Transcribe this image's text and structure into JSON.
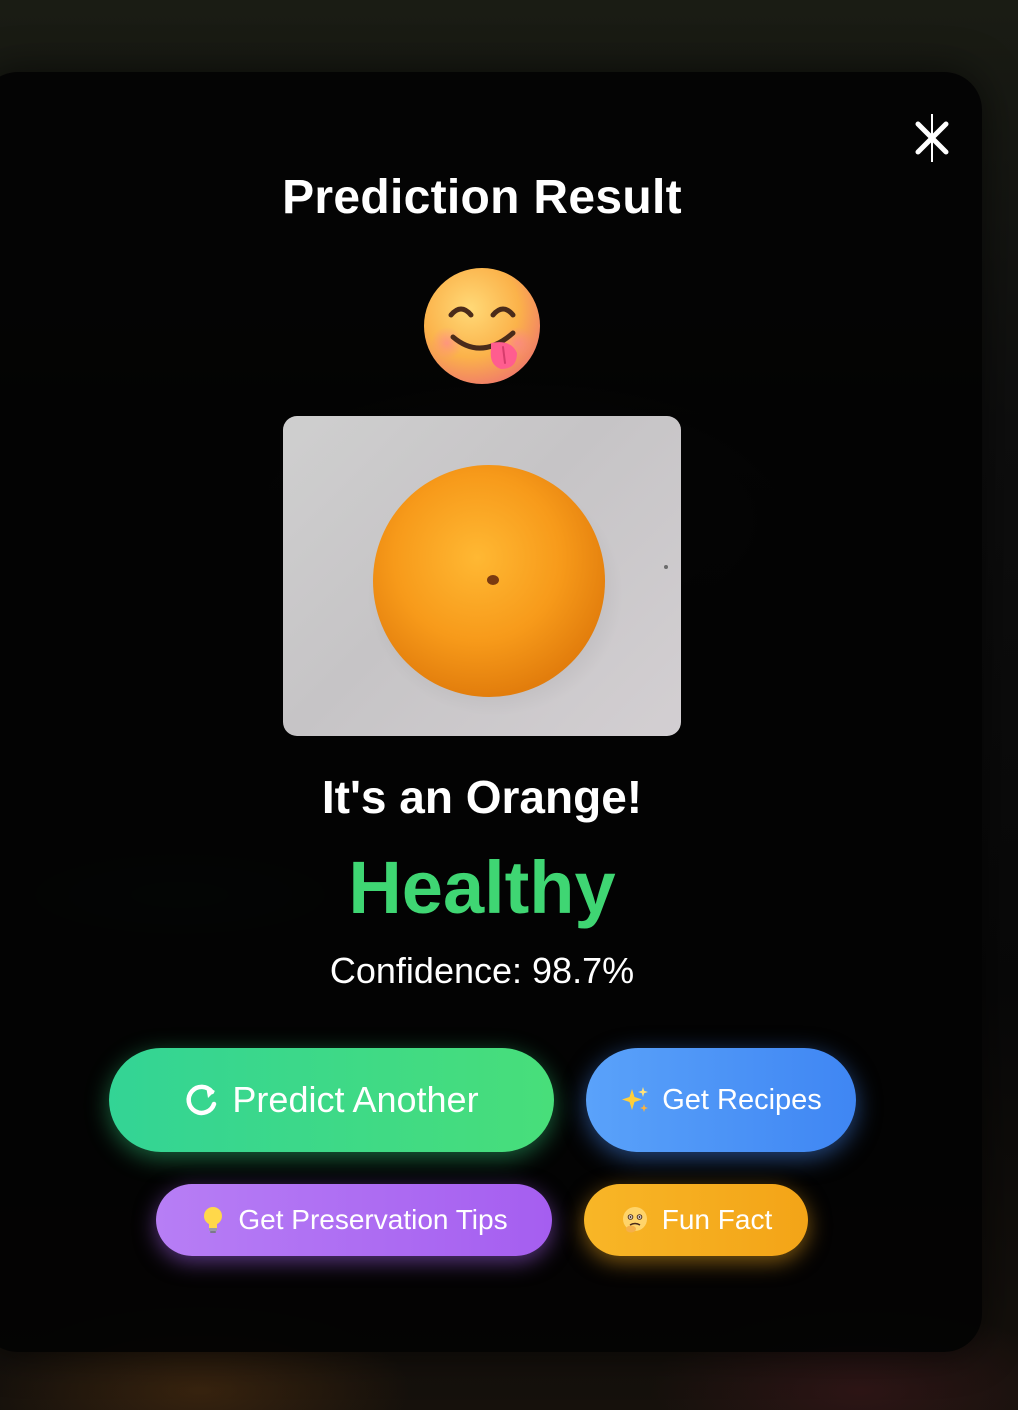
{
  "modal": {
    "title": "Prediction Result",
    "close_icon": "close-icon",
    "reaction_icon": "yum-face-emoji-icon",
    "fruit_image": "orange-photo",
    "fruit_label": "It's an Orange!",
    "health_status": "Healthy",
    "confidence_text": "Confidence: 98.7%"
  },
  "actions": {
    "predict_another": {
      "label": "Predict Another",
      "icon": "refresh-icon",
      "color": "#3fd88a"
    },
    "get_recipes": {
      "label": "Get Recipes",
      "icon": "sparkles-icon",
      "color": "#4a8ff6"
    },
    "preservation_tips": {
      "label": "Get Preservation Tips",
      "icon": "lightbulb-icon",
      "color": "#ad6ef2"
    },
    "fun_fact": {
      "label": "Fun Fact",
      "icon": "thinking-face-icon",
      "color": "#f6ad20"
    }
  },
  "colors": {
    "healthy": "#3fd673",
    "modal_background": "#030303"
  }
}
